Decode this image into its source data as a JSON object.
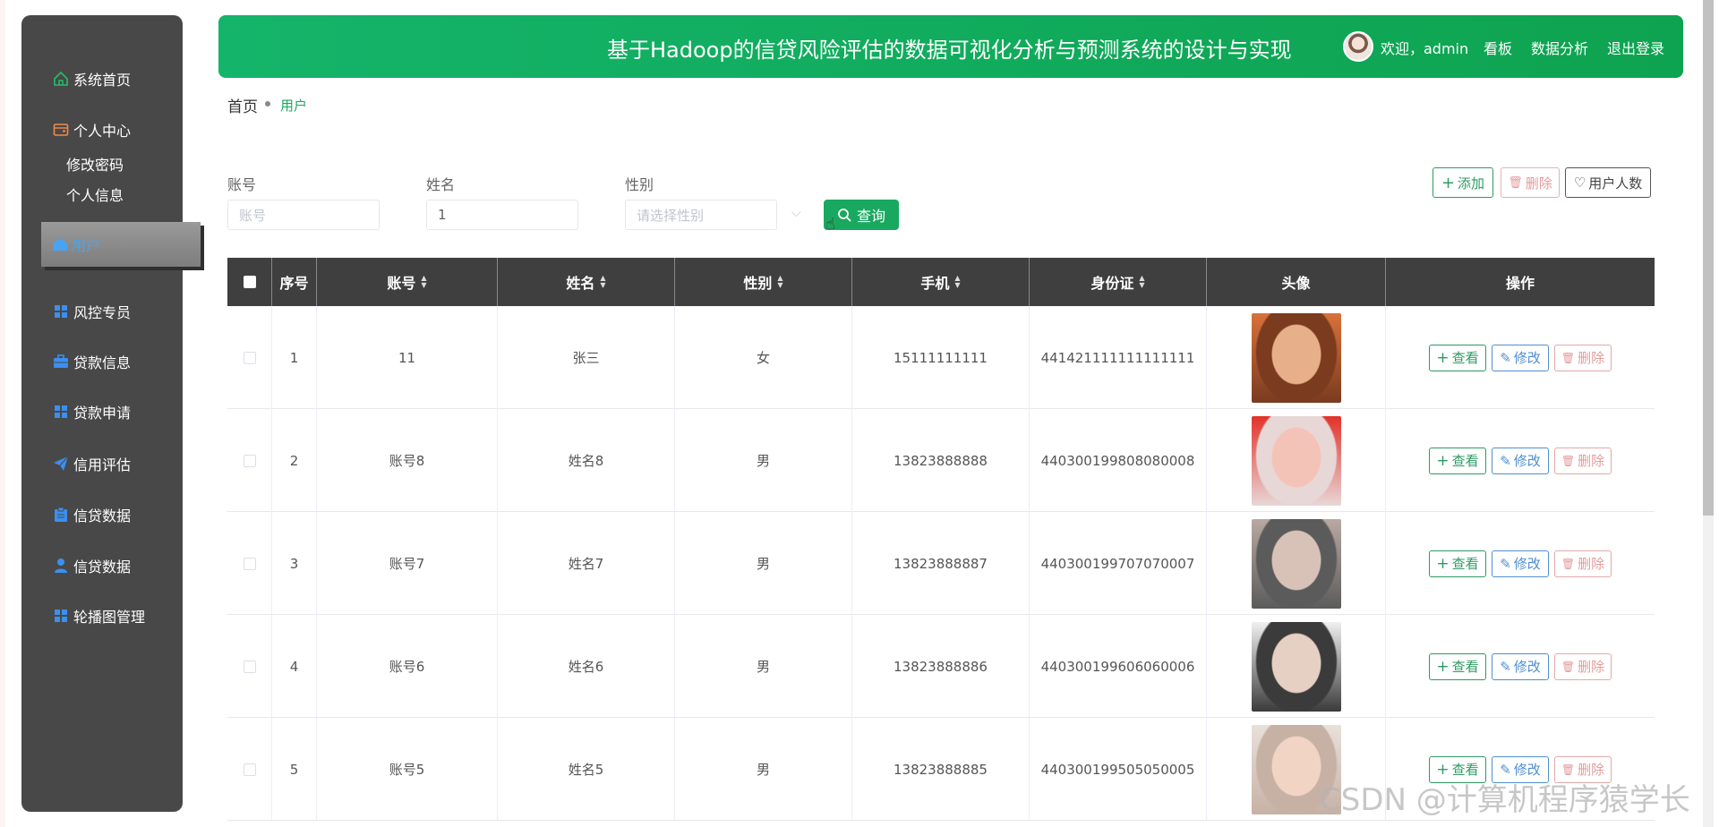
{
  "header": {
    "title": "基于Hadoop的信贷风险评估的数据可视化分析与预测系统的设计与实现",
    "welcome": "欢迎，admin",
    "dashboard_link": "看板",
    "analysis_link": "数据分析",
    "logout_link": "退出登录"
  },
  "sidebar": {
    "items": [
      {
        "label": "系统首页",
        "icon": "home-icon"
      },
      {
        "label": "个人中心",
        "icon": "wallet-icon"
      },
      {
        "label": "修改密码"
      },
      {
        "label": "个人信息"
      },
      {
        "label": "用户",
        "icon": "user-home-icon",
        "active": true
      },
      {
        "label": "风控专员",
        "icon": "grid-icon"
      },
      {
        "label": "贷款信息",
        "icon": "briefcase-icon"
      },
      {
        "label": "贷款申请",
        "icon": "grid-icon"
      },
      {
        "label": "信用评估",
        "icon": "paper-plane-icon"
      },
      {
        "label": "信贷数据",
        "icon": "clipboard-icon"
      },
      {
        "label": "信贷数据",
        "icon": "person-icon"
      },
      {
        "label": "轮播图管理",
        "icon": "grid-icon"
      }
    ]
  },
  "breadcrumb": {
    "home": "首页",
    "current": "用户"
  },
  "filters": {
    "account_label": "账号",
    "account_placeholder": "账号",
    "name_label": "姓名",
    "name_value": "1",
    "gender_label": "性别",
    "gender_placeholder": "请选择性别",
    "search_label": "查询"
  },
  "toolbar": {
    "add_label": "添加",
    "delete_label": "删除",
    "count_label": "用户人数"
  },
  "table": {
    "columns": [
      "序号",
      "账号",
      "姓名",
      "性别",
      "手机",
      "身份证",
      "头像",
      "操作"
    ],
    "rows": [
      {
        "no": "1",
        "account": "11",
        "name": "张三",
        "gender": "女",
        "phone": "15111111111",
        "idcard": "441421111111111111"
      },
      {
        "no": "2",
        "account": "账号8",
        "name": "姓名8",
        "gender": "男",
        "phone": "13823888888",
        "idcard": "440300199808080008"
      },
      {
        "no": "3",
        "account": "账号7",
        "name": "姓名7",
        "gender": "男",
        "phone": "13823888887",
        "idcard": "440300199707070007"
      },
      {
        "no": "4",
        "account": "账号6",
        "name": "姓名6",
        "gender": "男",
        "phone": "13823888886",
        "idcard": "440300199606060006"
      },
      {
        "no": "5",
        "account": "账号5",
        "name": "姓名5",
        "gender": "男",
        "phone": "13823888885",
        "idcard": "440300199505050005"
      }
    ],
    "view_label": "查看",
    "edit_label": "修改",
    "delete_label": "删除"
  },
  "watermark": "CSDN @计算机程序猿学长",
  "colors": {
    "header": "#14b46a",
    "sidebar": "#484848",
    "table_header": "#3f3f3f",
    "accent_green": "#19a85f"
  }
}
